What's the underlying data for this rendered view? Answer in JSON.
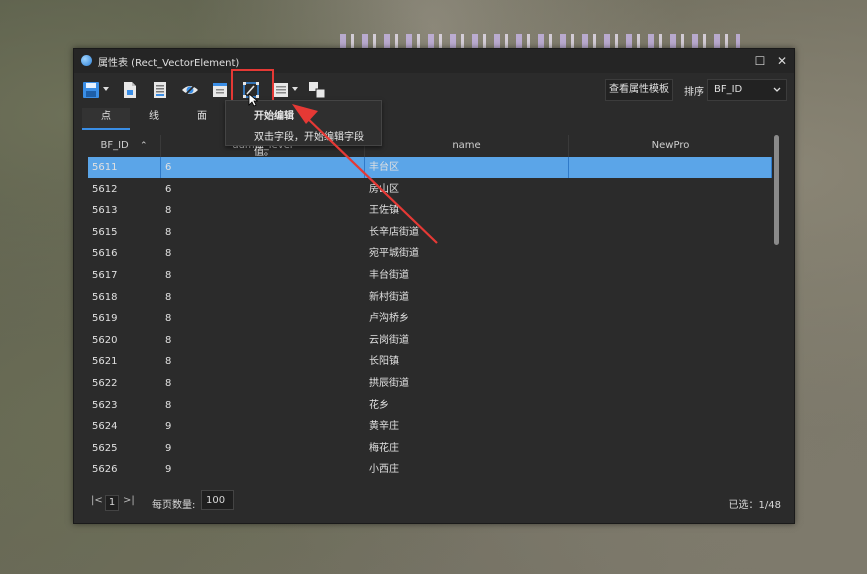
{
  "window": {
    "title": "属性表 (Rect_VectorElement)",
    "minimize_symbol": "☐",
    "close_symbol": "✕"
  },
  "toolbar": {
    "view_template_label": "查看属性模板",
    "sort_label": "排序",
    "sort_value": "BF_ID",
    "icons": [
      "save-icon",
      "export-icon",
      "document-icon",
      "eye-icon",
      "filter-icon",
      "edit-icon",
      "field-icon",
      "merge-icon"
    ]
  },
  "tooltip": {
    "title": "开始编辑",
    "text": "双击字段，开始编辑字段值。"
  },
  "tabs": [
    "点",
    "线",
    "面"
  ],
  "table": {
    "columns": [
      "BF_ID",
      "admin_level",
      "name",
      "NewPro"
    ],
    "sort_glyph": "⌃",
    "rows": [
      [
        "5611",
        "6",
        "丰台区",
        ""
      ],
      [
        "5612",
        "6",
        "房山区",
        ""
      ],
      [
        "5613",
        "8",
        "王佐镇",
        ""
      ],
      [
        "5615",
        "8",
        "长辛店街道",
        ""
      ],
      [
        "5616",
        "8",
        "宛平城街道",
        ""
      ],
      [
        "5617",
        "8",
        "丰台街道",
        ""
      ],
      [
        "5618",
        "8",
        "新村街道",
        ""
      ],
      [
        "5619",
        "8",
        "卢沟桥乡",
        ""
      ],
      [
        "5620",
        "8",
        "云岗街道",
        ""
      ],
      [
        "5621",
        "8",
        "长阳镇",
        ""
      ],
      [
        "5622",
        "8",
        "拱辰街道",
        ""
      ],
      [
        "5623",
        "8",
        "花乡",
        ""
      ],
      [
        "5624",
        "9",
        "黄辛庄",
        ""
      ],
      [
        "5625",
        "9",
        "梅花庄",
        ""
      ],
      [
        "5626",
        "9",
        "小西庄",
        ""
      ]
    ]
  },
  "footer": {
    "first_symbol": "|<",
    "page": "1",
    "last_symbol": ">|",
    "per_page_label": "每页数量:",
    "per_page_value": "100",
    "selected_text": "已选：1/48"
  },
  "colors": {
    "window_bg": "#2b2b2b",
    "selection": "#5ba5e8",
    "highlight": "#e53935"
  }
}
